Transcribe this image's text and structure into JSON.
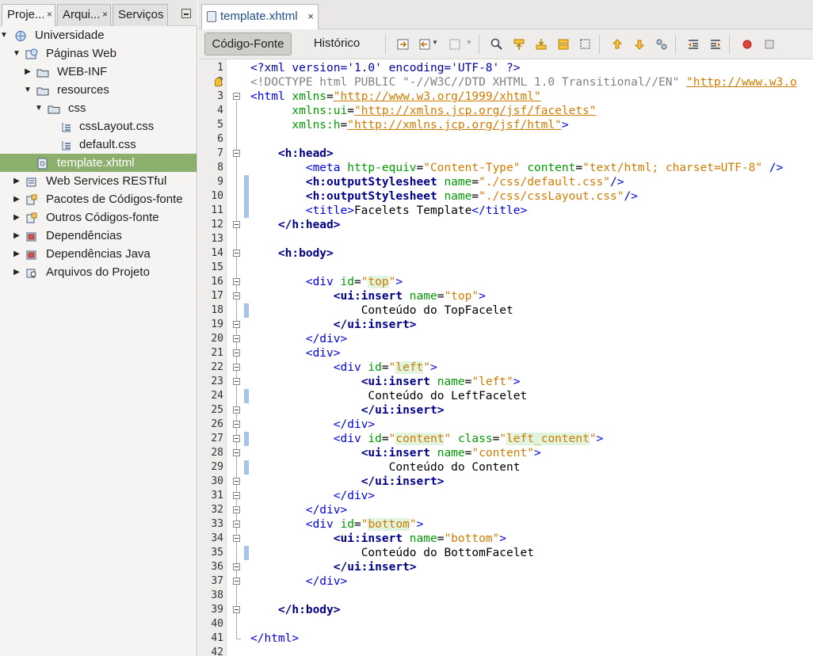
{
  "left_panel": {
    "tabs": [
      {
        "label": "Proje...",
        "close": "×"
      },
      {
        "label": "Arqui...",
        "close": "×"
      },
      {
        "label": "Serviços",
        "close": ""
      }
    ],
    "tree": [
      {
        "label": "Universidade",
        "icon": "project-icon",
        "level": 0,
        "arrow": "▼",
        "selected": false
      },
      {
        "label": "Páginas Web",
        "icon": "web-pages-icon",
        "level": 1,
        "arrow": "▼",
        "selected": false
      },
      {
        "label": "WEB-INF",
        "icon": "folder-icon",
        "level": 2,
        "arrow": "▶",
        "selected": false
      },
      {
        "label": "resources",
        "icon": "folder-icon",
        "level": 2,
        "arrow": "▼",
        "selected": false
      },
      {
        "label": "css",
        "icon": "folder-icon",
        "level": 3,
        "arrow": "▼",
        "selected": false
      },
      {
        "label": "cssLayout.css",
        "icon": "css-file-icon",
        "level": 4,
        "arrow": "",
        "selected": false
      },
      {
        "label": "default.css",
        "icon": "css-file-icon",
        "level": 4,
        "arrow": "",
        "selected": false
      },
      {
        "label": "template.xhtml",
        "icon": "xhtml-file-icon",
        "level": 3,
        "arrow": "",
        "selected": true
      },
      {
        "label": "Web Services RESTful",
        "icon": "rest-icon",
        "level": 1,
        "arrow": "▶",
        "selected": false
      },
      {
        "label": "Pacotes de Códigos-fonte",
        "icon": "package-icon",
        "level": 1,
        "arrow": "▶",
        "selected": false
      },
      {
        "label": "Outros Códigos-fonte",
        "icon": "package-icon",
        "level": 1,
        "arrow": "▶",
        "selected": false
      },
      {
        "label": "Dependências",
        "icon": "library-icon",
        "level": 1,
        "arrow": "▶",
        "selected": false
      },
      {
        "label": "Dependências Java",
        "icon": "library-icon",
        "level": 1,
        "arrow": "▶",
        "selected": false
      },
      {
        "label": "Arquivos do Projeto",
        "icon": "project-files-icon",
        "level": 1,
        "arrow": "▶",
        "selected": false
      }
    ]
  },
  "editor": {
    "tab_label": "template.xhtml",
    "tab_close": "×",
    "view_buttons": {
      "source": "Código-Fonte",
      "history": "Histórico"
    },
    "colors": {
      "tag": "#0000e6",
      "attr": "#009900",
      "value": "#ce7b00",
      "selection": "#8daf6d"
    },
    "lines": [
      [
        [
          "pi",
          "<?xml version='1.0' encoding='UTF-8' ?>"
        ]
      ],
      [
        [
          "dt",
          "<!DOCTYPE html PUBLIC \"-//W3C//DTD XHTML 1.0 Transitional//EN\" "
        ],
        [
          "url",
          "\"http://www.w3.o"
        ]
      ],
      [
        [
          "tag",
          "<html "
        ],
        [
          "attr",
          "xmlns"
        ],
        [
          "eq",
          "="
        ],
        [
          "url",
          "\"http://www.w3.org/1999/xhtml\""
        ]
      ],
      [
        [
          "sp",
          "      "
        ],
        [
          "attr",
          "xmlns:ui"
        ],
        [
          "eq",
          "="
        ],
        [
          "url",
          "\"http://xmlns.jcp.org/jsf/facelets\""
        ]
      ],
      [
        [
          "sp",
          "      "
        ],
        [
          "attr",
          "xmlns:h"
        ],
        [
          "eq",
          "="
        ],
        [
          "url",
          "\"http://xmlns.jcp.org/jsf/html\""
        ],
        [
          "tag",
          ">"
        ]
      ],
      [],
      [
        [
          "sp",
          "    "
        ],
        [
          "tagb",
          "<h:head>"
        ]
      ],
      [
        [
          "sp",
          "        "
        ],
        [
          "tag",
          "<meta "
        ],
        [
          "attr",
          "http-equiv"
        ],
        [
          "eq",
          "="
        ],
        [
          "val",
          "\"Content-Type\""
        ],
        [
          "sp",
          " "
        ],
        [
          "attr",
          "content"
        ],
        [
          "eq",
          "="
        ],
        [
          "val",
          "\"text/html; charset=UTF-8\""
        ],
        [
          "tag",
          " />"
        ]
      ],
      [
        [
          "sp",
          "        "
        ],
        [
          "tagb",
          "<h:outputStylesheet "
        ],
        [
          "attr",
          "name"
        ],
        [
          "eq",
          "="
        ],
        [
          "val",
          "\"./css/default.css\""
        ],
        [
          "tag",
          "/>"
        ]
      ],
      [
        [
          "sp",
          "        "
        ],
        [
          "tagb",
          "<h:outputStylesheet "
        ],
        [
          "attr",
          "name"
        ],
        [
          "eq",
          "="
        ],
        [
          "val",
          "\"./css/cssLayout.css\""
        ],
        [
          "tag",
          "/>"
        ]
      ],
      [
        [
          "sp",
          "        "
        ],
        [
          "tag",
          "<title>"
        ],
        [
          "txt",
          "Facelets Template"
        ],
        [
          "tag",
          "</title>"
        ]
      ],
      [
        [
          "sp",
          "    "
        ],
        [
          "tagb",
          "</h:head>"
        ]
      ],
      [],
      [
        [
          "sp",
          "    "
        ],
        [
          "tagb",
          "<h:body>"
        ]
      ],
      [],
      [
        [
          "sp",
          "        "
        ],
        [
          "tag",
          "<div "
        ],
        [
          "attr",
          "id"
        ],
        [
          "eq",
          "="
        ],
        [
          "val",
          "\""
        ],
        [
          "hl",
          "top"
        ],
        [
          "val",
          "\""
        ],
        [
          "tag",
          ">"
        ]
      ],
      [
        [
          "sp",
          "            "
        ],
        [
          "tagb",
          "<ui:insert "
        ],
        [
          "attr",
          "name"
        ],
        [
          "eq",
          "="
        ],
        [
          "val",
          "\"top\""
        ],
        [
          "tag",
          ">"
        ]
      ],
      [
        [
          "sp",
          "                "
        ],
        [
          "txt",
          "Conteúdo do TopFacelet"
        ]
      ],
      [
        [
          "sp",
          "            "
        ],
        [
          "tagb",
          "</ui:insert>"
        ]
      ],
      [
        [
          "sp",
          "        "
        ],
        [
          "tag",
          "</div>"
        ]
      ],
      [
        [
          "sp",
          "        "
        ],
        [
          "tag",
          "<div>"
        ]
      ],
      [
        [
          "sp",
          "            "
        ],
        [
          "tag",
          "<div "
        ],
        [
          "attr",
          "id"
        ],
        [
          "eq",
          "="
        ],
        [
          "val",
          "\""
        ],
        [
          "hl",
          "left"
        ],
        [
          "val",
          "\""
        ],
        [
          "tag",
          ">"
        ]
      ],
      [
        [
          "sp",
          "                "
        ],
        [
          "tagb",
          "<ui:insert "
        ],
        [
          "attr",
          "name"
        ],
        [
          "eq",
          "="
        ],
        [
          "val",
          "\"left\""
        ],
        [
          "tag",
          ">"
        ]
      ],
      [
        [
          "sp",
          "                 "
        ],
        [
          "txt",
          "Conteúdo do LeftFacelet"
        ]
      ],
      [
        [
          "sp",
          "                "
        ],
        [
          "tagb",
          "</ui:insert>"
        ]
      ],
      [
        [
          "sp",
          "            "
        ],
        [
          "tag",
          "</div>"
        ]
      ],
      [
        [
          "sp",
          "            "
        ],
        [
          "tag",
          "<div "
        ],
        [
          "attr",
          "id"
        ],
        [
          "eq",
          "="
        ],
        [
          "val",
          "\""
        ],
        [
          "hl",
          "content"
        ],
        [
          "val",
          "\""
        ],
        [
          "sp",
          " "
        ],
        [
          "attr",
          "class"
        ],
        [
          "eq",
          "="
        ],
        [
          "val",
          "\""
        ],
        [
          "hl",
          "left_content"
        ],
        [
          "val",
          "\""
        ],
        [
          "tag",
          ">"
        ]
      ],
      [
        [
          "sp",
          "                "
        ],
        [
          "tagb",
          "<ui:insert "
        ],
        [
          "attr",
          "name"
        ],
        [
          "eq",
          "="
        ],
        [
          "val",
          "\"content\""
        ],
        [
          "tag",
          ">"
        ]
      ],
      [
        [
          "sp",
          "                    "
        ],
        [
          "txt",
          "Conteúdo do Content"
        ]
      ],
      [
        [
          "sp",
          "                "
        ],
        [
          "tagb",
          "</ui:insert>"
        ]
      ],
      [
        [
          "sp",
          "            "
        ],
        [
          "tag",
          "</div>"
        ]
      ],
      [
        [
          "sp",
          "        "
        ],
        [
          "tag",
          "</div>"
        ]
      ],
      [
        [
          "sp",
          "        "
        ],
        [
          "tag",
          "<div "
        ],
        [
          "attr",
          "id"
        ],
        [
          "eq",
          "="
        ],
        [
          "val",
          "\""
        ],
        [
          "hl",
          "bottom"
        ],
        [
          "val",
          "\""
        ],
        [
          "tag",
          ">"
        ]
      ],
      [
        [
          "sp",
          "            "
        ],
        [
          "tagb",
          "<ui:insert "
        ],
        [
          "attr",
          "name"
        ],
        [
          "eq",
          "="
        ],
        [
          "val",
          "\"bottom\""
        ],
        [
          "tag",
          ">"
        ]
      ],
      [
        [
          "sp",
          "                "
        ],
        [
          "txt",
          "Conteúdo do BottomFacelet"
        ]
      ],
      [
        [
          "sp",
          "            "
        ],
        [
          "tagb",
          "</ui:insert>"
        ]
      ],
      [
        [
          "sp",
          "        "
        ],
        [
          "tag",
          "</div>"
        ]
      ],
      [],
      [
        [
          "sp",
          "    "
        ],
        [
          "tagb",
          "</h:body>"
        ]
      ],
      [],
      [
        [
          "tag",
          "</html>"
        ]
      ],
      []
    ]
  }
}
